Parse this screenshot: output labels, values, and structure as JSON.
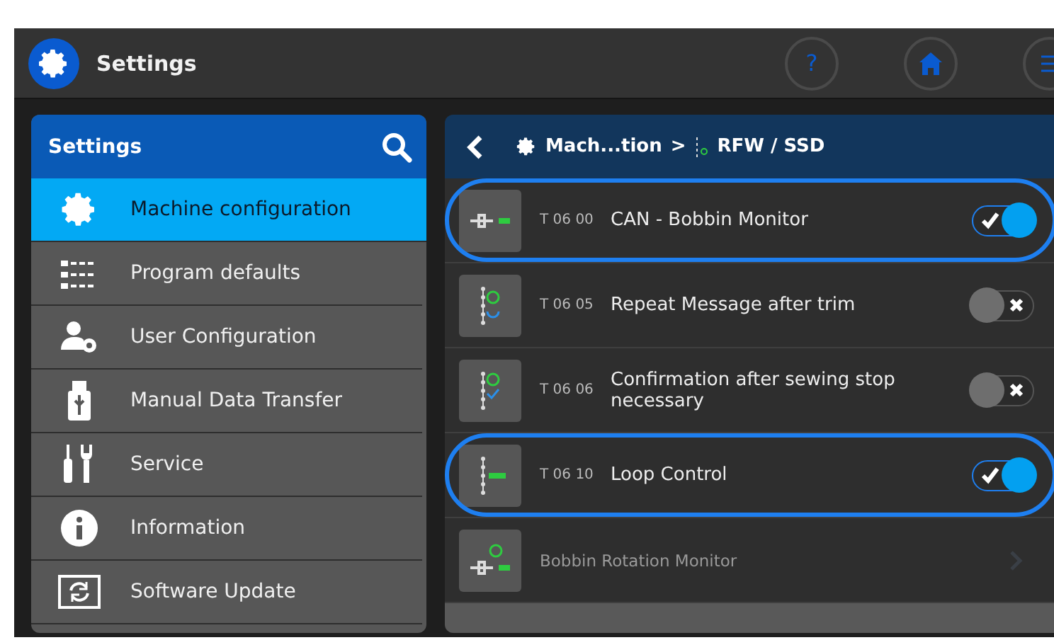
{
  "app_bar": {
    "title": "Settings",
    "buttons": [
      {
        "label": "?",
        "kind": "help"
      },
      {
        "kind": "home"
      },
      {
        "kind": "menu"
      }
    ]
  },
  "sidebar": {
    "title": "Settings",
    "items": [
      {
        "label": "Machine configuration",
        "selected": true
      },
      {
        "label": "Program defaults",
        "selected": false
      },
      {
        "label": "User Configuration",
        "selected": false
      },
      {
        "label": "Manual Data Transfer",
        "selected": false
      },
      {
        "label": "Service",
        "selected": false
      },
      {
        "label": "Information",
        "selected": false
      },
      {
        "label": "Software Update",
        "selected": false
      }
    ]
  },
  "detail": {
    "breadcrumb": [
      {
        "label": "Mach...tion"
      },
      {
        "label": "RFW / SSD"
      }
    ],
    "separator": ">",
    "rows": [
      {
        "kind": "toggle",
        "code": "T 06 00",
        "label": "CAN - Bobbin Monitor",
        "on": true,
        "highlighted": true
      },
      {
        "kind": "toggle",
        "code": "T 06 05",
        "label": "Repeat Message after trim",
        "on": false,
        "highlighted": false
      },
      {
        "kind": "toggle",
        "code": "T 06 06",
        "label": "Confirmation after sewing stop necessary",
        "on": false,
        "highlighted": false
      },
      {
        "kind": "toggle",
        "code": "T 06 10",
        "label": "Loop Control",
        "on": true,
        "highlighted": true
      },
      {
        "kind": "link",
        "label": "Bobbin Rotation Monitor",
        "disabled": true,
        "highlighted": false
      }
    ]
  }
}
